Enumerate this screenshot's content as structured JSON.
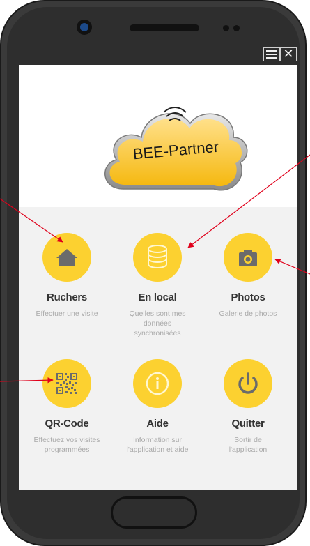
{
  "app": {
    "logo_text": "BEE-Partner"
  },
  "tiles": [
    {
      "icon": "home-icon",
      "title": "Ruchers",
      "desc": "Effectuer une visite"
    },
    {
      "icon": "database-icon",
      "title": "En local",
      "desc": "Quelles sont mes données synchronisées"
    },
    {
      "icon": "camera-icon",
      "title": "Photos",
      "desc": "Galerie de photos"
    },
    {
      "icon": "qr-code-icon",
      "title": "QR-Code",
      "desc": "Effectuez vos visites programmées"
    },
    {
      "icon": "info-icon",
      "title": "Aide",
      "desc": "Information sur l'application et aide"
    },
    {
      "icon": "power-icon",
      "title": "Quitter",
      "desc": "Sortir de l'application"
    }
  ],
  "colors": {
    "accent": "#fcd130",
    "icon": "#6b6b6b",
    "arrow": "#e0001b",
    "frame": "#2e2e2e"
  }
}
